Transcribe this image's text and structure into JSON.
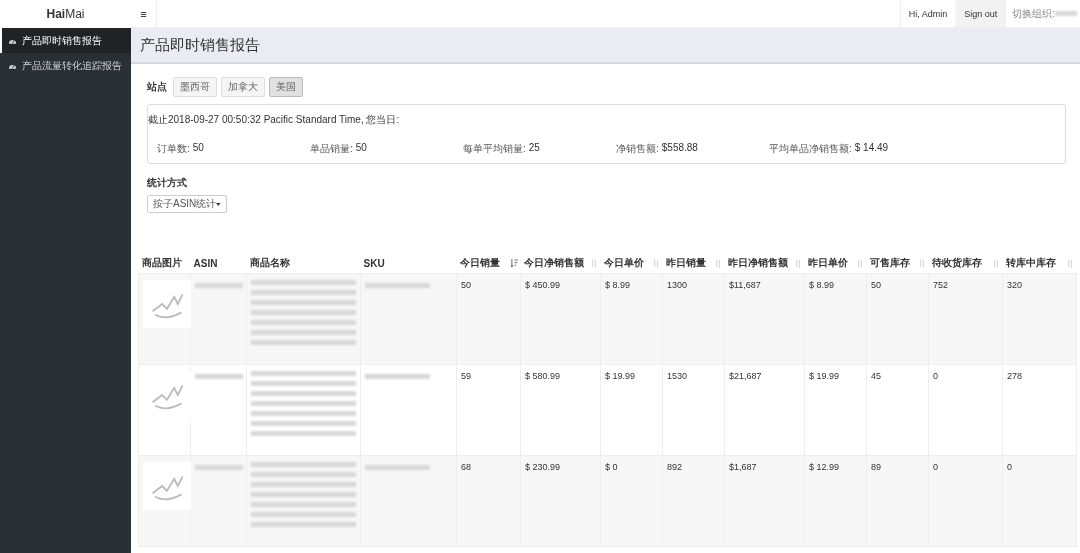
{
  "brand": {
    "bold": "Hai",
    "light": "Mai"
  },
  "menu_toggle": "≡",
  "user": {
    "greeting": "Hi, Admin",
    "sign_out": "Sign out",
    "org_label": "切换组织:"
  },
  "sidebar": {
    "items": [
      {
        "label": "产品即时销售报告",
        "selected": true
      },
      {
        "label": "产品流量转化追踪报告",
        "selected": false
      }
    ]
  },
  "page_title": "产品即时销售报告",
  "site": {
    "label": "站点",
    "options": [
      {
        "label": "墨西哥",
        "selected": false
      },
      {
        "label": "加拿大",
        "selected": false
      },
      {
        "label": "美国",
        "selected": true
      }
    ]
  },
  "summary": {
    "as_of": "截止2018-09-27 00:50:32 Pacific Standard Time,  您当日:",
    "stats": [
      {
        "label": "订单数:",
        "value": "50"
      },
      {
        "label": "单品销量:",
        "value": "50"
      },
      {
        "label": "每单平均销量:",
        "value": "25"
      },
      {
        "label": "净销售额:",
        "value": "$558.88"
      },
      {
        "label": "平均单品净销售额:",
        "value": "$ 14.49"
      }
    ]
  },
  "stat_method": {
    "label": "统计方式",
    "value": "按子ASIN统计"
  },
  "table": {
    "columns": [
      {
        "label": "商品图片",
        "kind": "plain",
        "sorted": false
      },
      {
        "label": "ASIN",
        "kind": "plain",
        "sorted": false
      },
      {
        "label": "商品名称",
        "kind": "plain",
        "sorted": false
      },
      {
        "label": "SKU",
        "kind": "plain",
        "sorted": false
      },
      {
        "label": "今日销量",
        "kind": "sortable",
        "sorted": true
      },
      {
        "label": "今日净销售额",
        "kind": "sortable",
        "sorted": false
      },
      {
        "label": "今日单价",
        "kind": "sortable",
        "sorted": false
      },
      {
        "label": "昨日销量",
        "kind": "sortable",
        "sorted": false
      },
      {
        "label": "昨日净销售额",
        "kind": "sortable",
        "sorted": false
      },
      {
        "label": "昨日单价",
        "kind": "sortable",
        "sorted": false
      },
      {
        "label": "可售库存",
        "kind": "sortable",
        "sorted": false
      },
      {
        "label": "待收货库存",
        "kind": "sortable",
        "sorted": false
      },
      {
        "label": "转库中库存",
        "kind": "sortable",
        "sorted": false
      }
    ],
    "rows": [
      {
        "cells": [
          "",
          "",
          "",
          "",
          "50",
          "$ 450.99",
          "$ 8.99",
          "1300",
          "$11,687",
          "$ 8.99",
          "50",
          "752",
          "320"
        ]
      },
      {
        "cells": [
          "",
          "",
          "",
          "",
          "59",
          "$ 580.99",
          "$ 19.99",
          "1530",
          "$21,687",
          "$ 19.99",
          "45",
          "0",
          "278"
        ]
      },
      {
        "cells": [
          "",
          "",
          "",
          "",
          "68",
          "$ 230.99",
          "$ 0",
          "892",
          "$1,687",
          "$ 12.99",
          "89",
          "0",
          "0"
        ]
      }
    ]
  }
}
